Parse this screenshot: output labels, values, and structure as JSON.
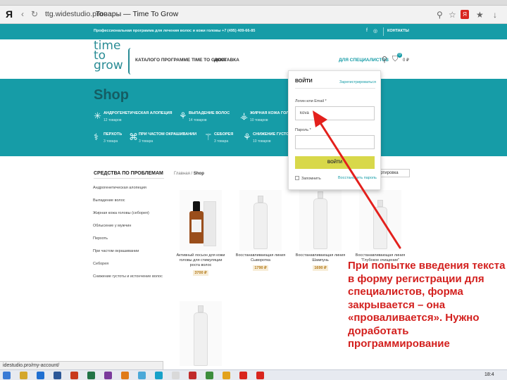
{
  "browser": {
    "yandex_logo": "Я",
    "back_icon": "arrow-left-icon",
    "reload_icon": "reload-icon",
    "url": "ttg.widestudio.pro",
    "page_title": "Товары — Time To Grow",
    "star_icon": "star-icon",
    "search_icon": "search-icon",
    "block_icon": "yandex-protect-icon",
    "download_icon": "download-icon"
  },
  "topstrip": {
    "text": "Профессиональная программа для лечения волос и кожи головы  +7 (495) 409-66-85",
    "contacts": "КОНТАКТЫ",
    "social_icons": [
      "facebook-icon",
      "instagram-icon"
    ]
  },
  "header": {
    "logo_lines": [
      "time",
      "to",
      "grow"
    ],
    "nav": [
      "КАТАЛОГ",
      "О ПРОГРАММЕ TIME TO GROW",
      "ДОСТАВКА"
    ],
    "nav_accent": "ДЛЯ СПЕЦИАЛИСТОВ",
    "cart_count": "0",
    "cart_sum": "0 ₽"
  },
  "hero": {
    "title": "Shop",
    "categories": [
      {
        "name": "АНДРОГЕНЕТИЧЕСКАЯ АЛОПЕЦИЯ",
        "count": "12 товаров",
        "icon": "hair-icon"
      },
      {
        "name": "ВЫПАДЕНИЕ ВОЛОС",
        "count": "14 товаров",
        "icon": "hair-loss-icon"
      },
      {
        "name": "ЖИРНАЯ КОЖА ГОЛ",
        "count": "10 товаров",
        "icon": "oily-scalp-icon"
      },
      {
        "name": "ПЕРХОТЬ",
        "count": "3 товара",
        "icon": "dandruff-icon"
      },
      {
        "name": "ПРИ ЧАСТОМ ОКРАШИВАНИИ",
        "count": "3 товара",
        "icon": "dye-icon"
      },
      {
        "name": "СЕБОРЕЯ",
        "count": "3 товара",
        "icon": "seborrhea-icon"
      },
      {
        "name": "СНИЖЕНИЕ ГУСТОТ",
        "count": "10 товаров",
        "icon": "thinning-icon"
      }
    ]
  },
  "sidebar": {
    "title": "СРЕДСТВА ПО ПРОБЛЕМАМ",
    "items": [
      "Андрогенетическая алопеция",
      "Выпадение волос",
      "Жирная кожа головы (себорея)",
      "Облысение у мужчин",
      "Перхоть",
      "При частом окрашивании",
      "Себорея",
      "Снижение густоты и истончение волос"
    ]
  },
  "main": {
    "breadcrumb_home": "Главная",
    "breadcrumb_sep": " / ",
    "breadcrumb_current": "Shop",
    "sort_label": "ортировка",
    "products": [
      {
        "name": "Активный лосьон для кожи головы для стимуляции роста волос",
        "price": "3700 ₽"
      },
      {
        "name": "Восстанавливающая линия Сыворотка",
        "price": "1790 ₽"
      },
      {
        "name": "Восстанавливающая линия Шампунь",
        "price": "1690 ₽"
      },
      {
        "name": "Восстанавливающая линия \"Глубокое очищение\"",
        "price": ""
      },
      {
        "name": "",
        "price": ""
      }
    ]
  },
  "login": {
    "title": "ВОЙТИ",
    "register": "Зарегистрироваться",
    "login_label": "Логин или Email *",
    "login_value": "kova",
    "password_label": "Пароль *",
    "password_value": "",
    "submit": "ВОЙТИ",
    "remember": "Запомнить",
    "forgot": "Восстановить пароль"
  },
  "annotation": {
    "text": "При попытке введения текста в форму регистрации для специалистов, форма закрывается – она «проваливается». Нужно доработать программирование",
    "color": "#d3201e"
  },
  "statusbar": {
    "link": "idestudio.pro/my-account/"
  },
  "taskbar": {
    "clock": "18:4"
  },
  "colors": {
    "teal": "#169ca7",
    "button_yellow": "#d8d84a",
    "price": "#b47a1a"
  }
}
